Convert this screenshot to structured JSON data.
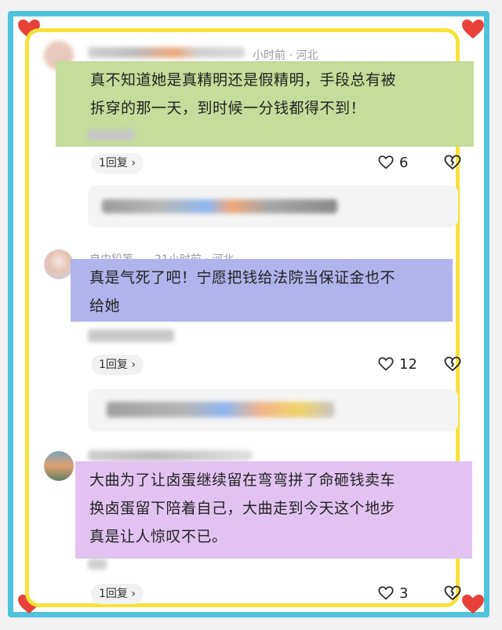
{
  "comments": [
    {
      "meta": "小时前 · 河北",
      "text_line1": "真不知道她是真精明还是假精明，手段总有被",
      "text_line2": "拆穿的那一天，到时候一分钱都得不到！",
      "reply_label": "1回复",
      "reply_chevron": "›",
      "likes": "6",
      "highlight_color": "#c5dc9a"
    },
    {
      "username": "自由铅笔",
      "meta": "21小时前 · 河北",
      "text_line1": "真是气死了吧！宁愿把钱给法院当保证金也不",
      "text_line2": "给她",
      "reply_label": "1回复",
      "reply_chevron": "›",
      "likes": "12",
      "highlight_color": "#b1b3ec"
    },
    {
      "text_line1": "大曲为了让卤蛋继续留在弯弯拼了命砸钱卖车",
      "text_line2": "换卤蛋留下陪着自己，大曲走到今天这个地步",
      "text_line3": "真是让人惊叹不已。",
      "reply_label": "1回复",
      "reply_chevron": "›",
      "likes": "3",
      "highlight_color": "#e3c2f2"
    }
  ],
  "icons": {
    "heart": "heart-outline-icon",
    "dislike": "broken-heart-icon",
    "corner": "red-heart-icon"
  },
  "colors": {
    "outer_border": "#4fc3d9",
    "inner_border": "#f7e13a",
    "corner_heart": "#e8413a"
  }
}
